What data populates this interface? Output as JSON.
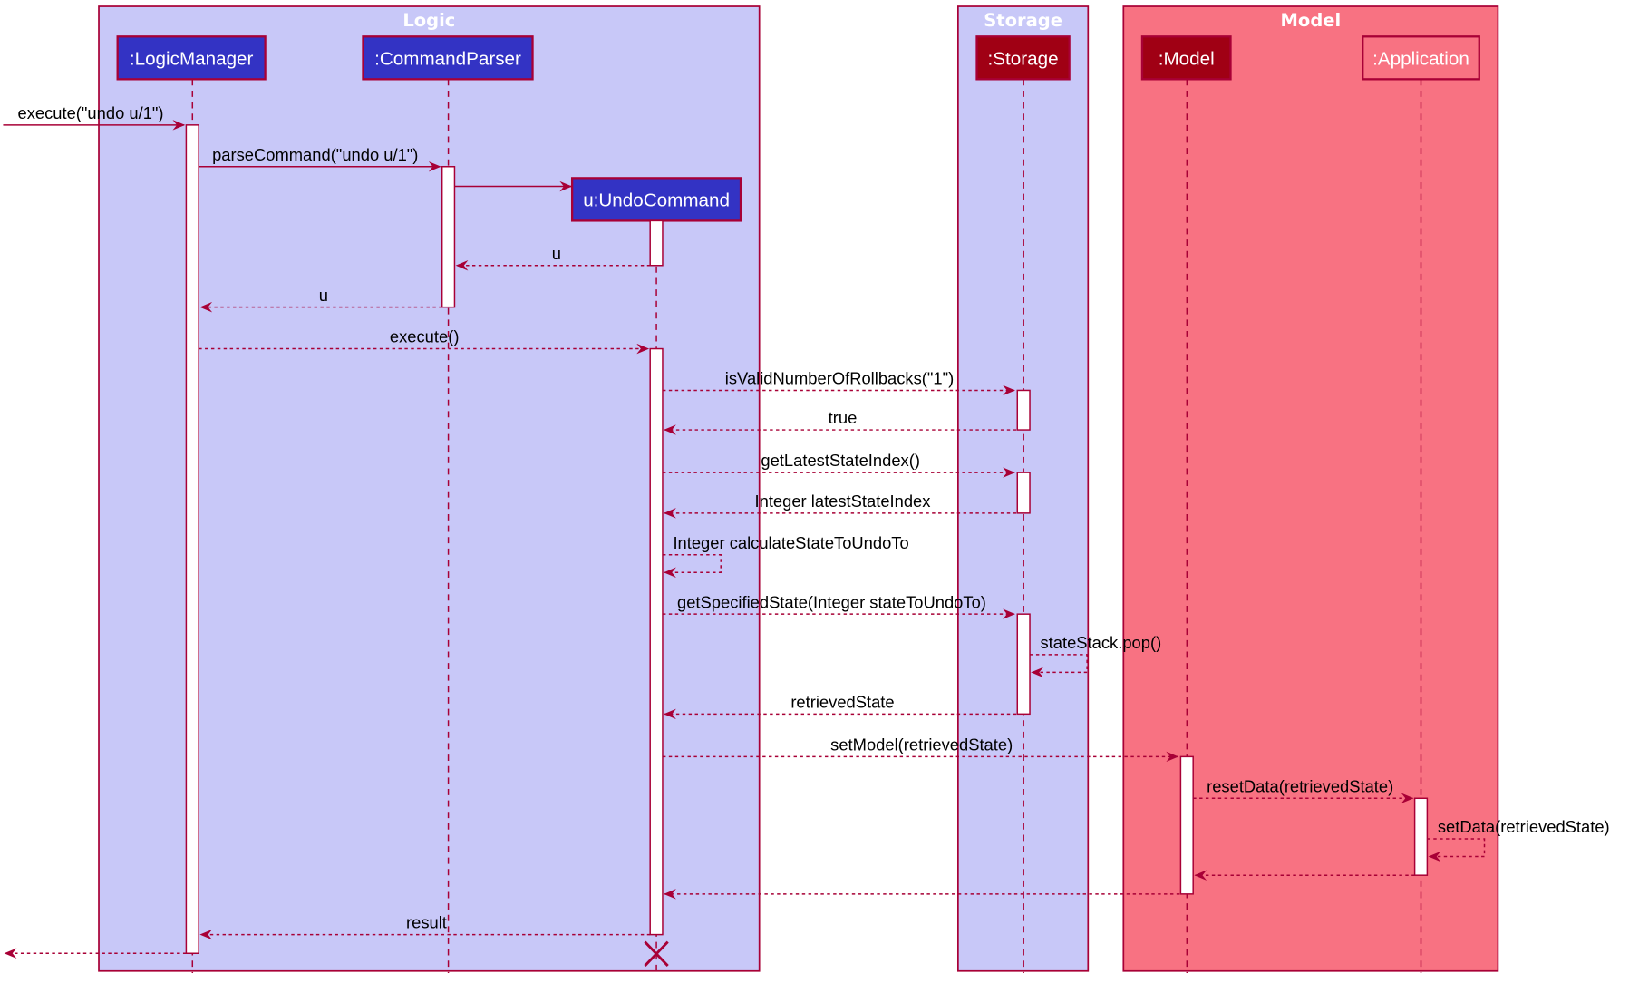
{
  "colors": {
    "border": "#A80036",
    "logic_frame_fill": "#C8C8F8",
    "storage_frame_fill": "#C8C8F8",
    "model_frame_fill": "#F87282",
    "blue_participant": "#3333C4",
    "red_participant": "#A00014",
    "activation_fill": "#FFFFFF"
  },
  "frames": [
    {
      "title": "Logic"
    },
    {
      "title": "Storage"
    },
    {
      "title": "Model"
    }
  ],
  "participants": [
    {
      "id": "lm",
      "label": ":LogicManager"
    },
    {
      "id": "cp",
      "label": ":CommandParser"
    },
    {
      "id": "uc",
      "label": "u:UndoCommand"
    },
    {
      "id": "st",
      "label": ":Storage"
    },
    {
      "id": "mo",
      "label": ":Model"
    },
    {
      "id": "ap",
      "label": ":Application"
    }
  ],
  "messages": [
    {
      "from": "external",
      "to": "lm",
      "label": "execute(\"undo u/1\")",
      "style": "solid"
    },
    {
      "from": "lm",
      "to": "cp",
      "label": "parseCommand(\"undo u/1\")",
      "style": "solid"
    },
    {
      "from": "cp",
      "to": "uc",
      "label": "",
      "style": "solid",
      "kind": "create"
    },
    {
      "from": "uc",
      "to": "cp",
      "label": "u",
      "style": "dashed"
    },
    {
      "from": "cp",
      "to": "lm",
      "label": "u",
      "style": "dashed"
    },
    {
      "from": "lm",
      "to": "uc",
      "label": "execute()",
      "style": "dashed"
    },
    {
      "from": "uc",
      "to": "st",
      "label": "isValidNumberOfRollbacks(\"1\")",
      "style": "dashed"
    },
    {
      "from": "st",
      "to": "uc",
      "label": "true",
      "style": "dashed"
    },
    {
      "from": "uc",
      "to": "st",
      "label": "getLatestStateIndex()",
      "style": "dashed"
    },
    {
      "from": "st",
      "to": "uc",
      "label": "Integer latestStateIndex",
      "style": "dashed"
    },
    {
      "from": "uc",
      "to": "uc",
      "label": "Integer calculateStateToUndoTo",
      "style": "dashed",
      "kind": "self"
    },
    {
      "from": "uc",
      "to": "st",
      "label": "getSpecifiedState(Integer stateToUndoTo)",
      "style": "dashed"
    },
    {
      "from": "st",
      "to": "st",
      "label": "stateStack.pop()",
      "style": "dashed",
      "kind": "self"
    },
    {
      "from": "st",
      "to": "uc",
      "label": "retrievedState",
      "style": "dashed"
    },
    {
      "from": "uc",
      "to": "mo",
      "label": "setModel(retrievedState)",
      "style": "dashed"
    },
    {
      "from": "mo",
      "to": "ap",
      "label": "resetData(retrievedState)",
      "style": "dashed"
    },
    {
      "from": "ap",
      "to": "ap",
      "label": "setData(retrievedState)",
      "style": "dashed",
      "kind": "self"
    },
    {
      "from": "ap",
      "to": "mo",
      "label": "",
      "style": "dashed"
    },
    {
      "from": "mo",
      "to": "uc",
      "label": "",
      "style": "dashed"
    },
    {
      "from": "uc",
      "to": "lm",
      "label": "result",
      "style": "dashed"
    },
    {
      "from": "lm",
      "to": "external",
      "label": "",
      "style": "dashed"
    }
  ],
  "destroyed": "uc"
}
